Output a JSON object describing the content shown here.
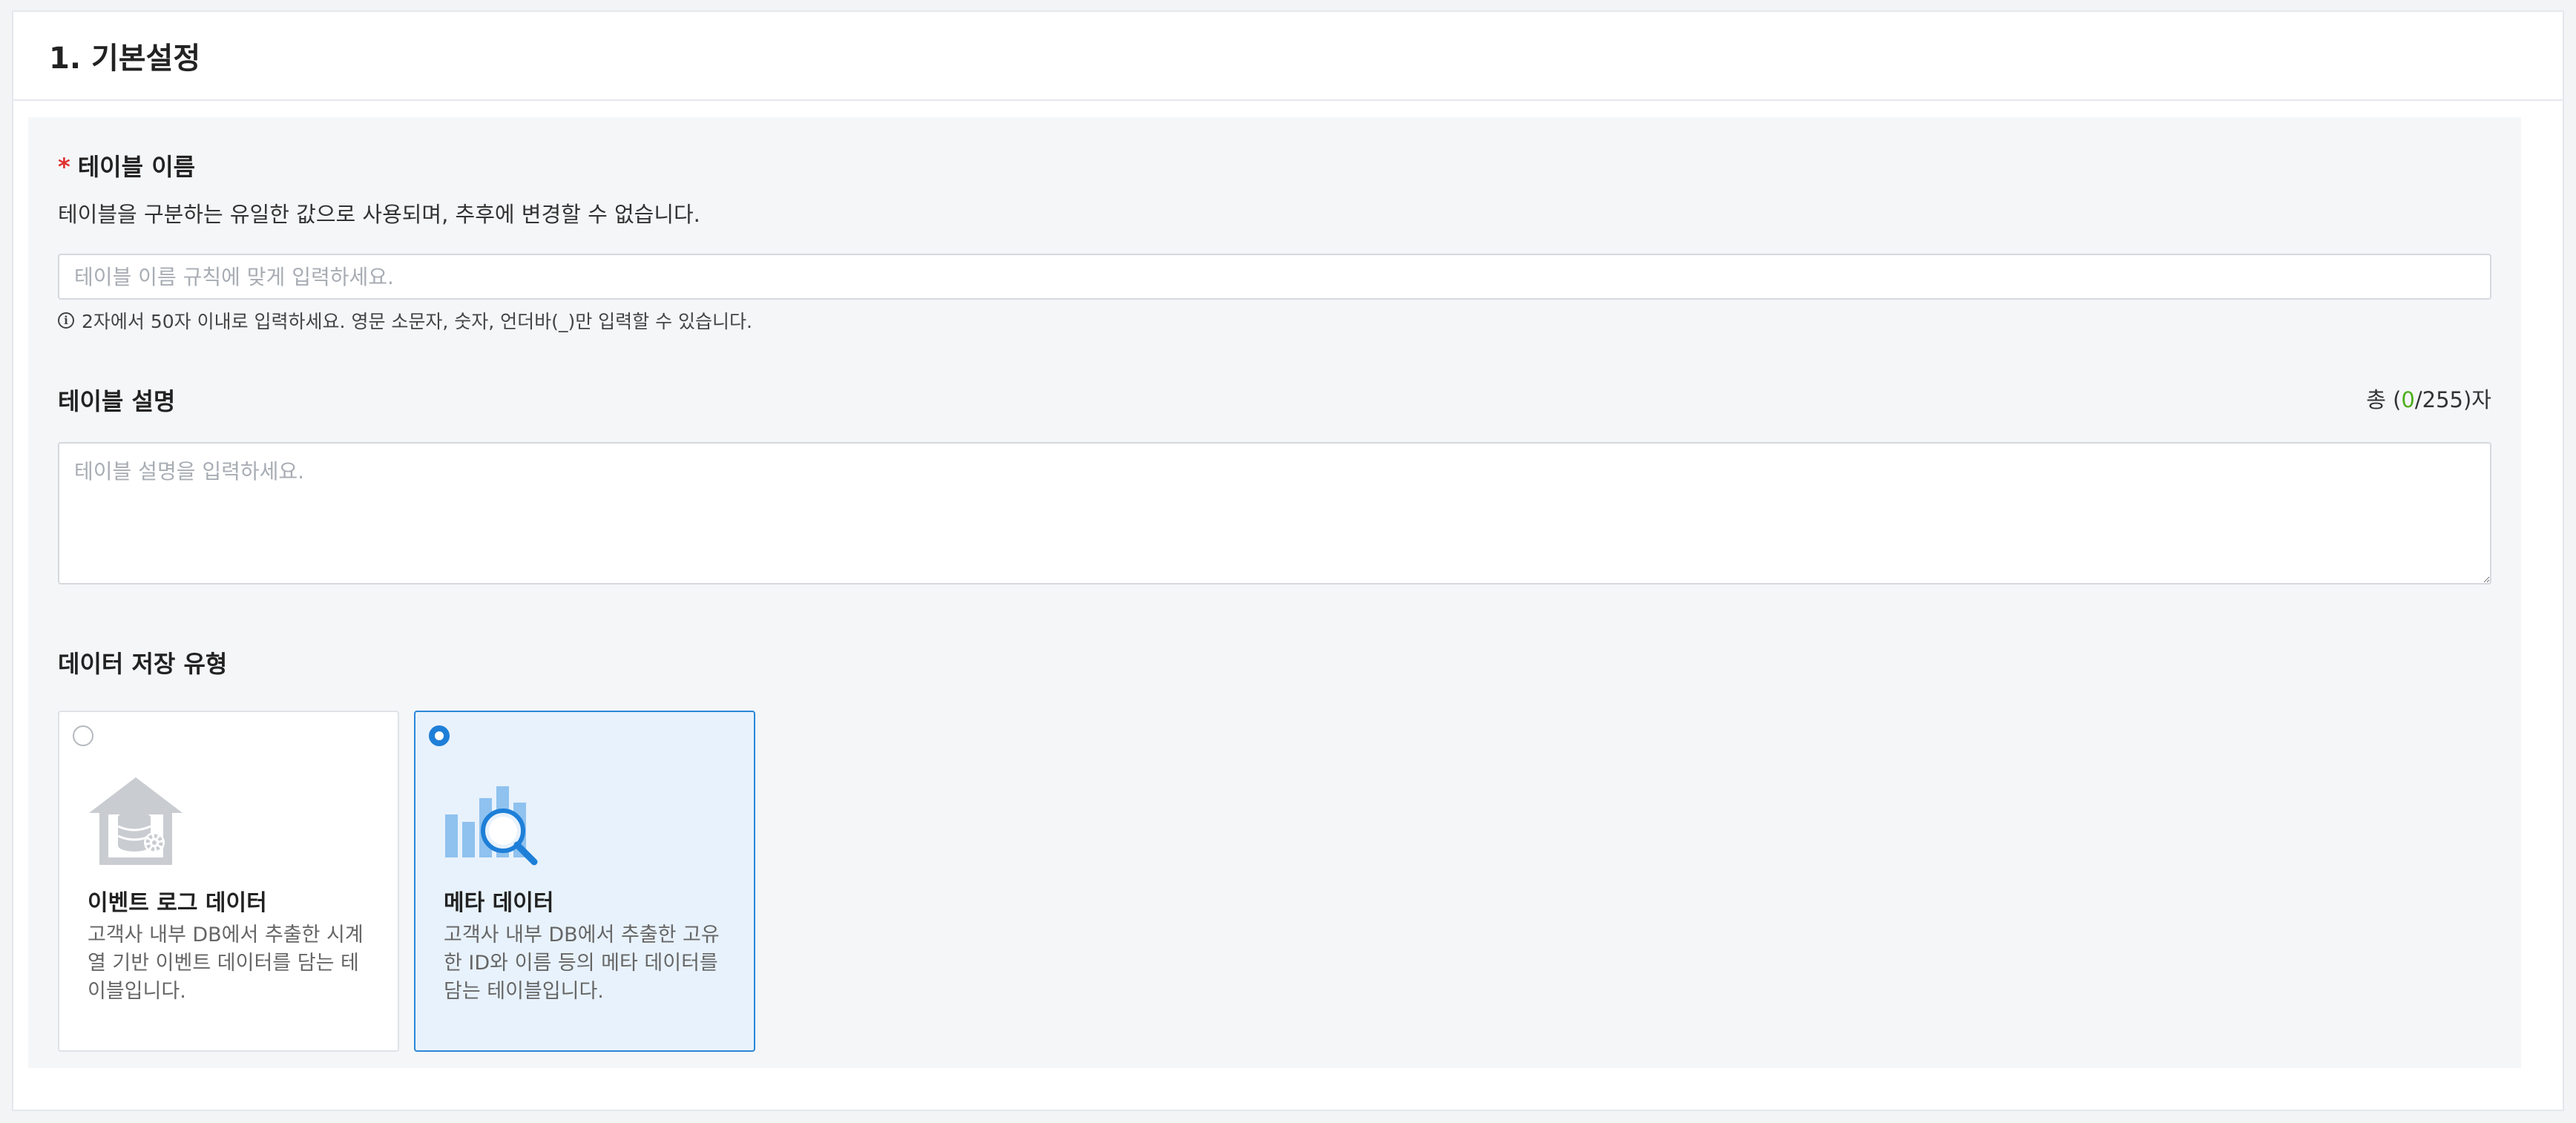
{
  "section": {
    "title": "1. 기본설정"
  },
  "table_name": {
    "required_mark": "*",
    "label": "테이블 이름",
    "description": "테이블을 구분하는 유일한 값으로 사용되며, 추후에 변경할 수 없습니다.",
    "value": "",
    "placeholder": "테이블 이름 규칙에 맞게 입력하세요.",
    "hint_icon": "info-icon",
    "hint": "2자에서 50자 이내로 입력하세요. 영문 소문자, 숫자, 언더바(_)만 입력할 수 있습니다."
  },
  "table_description": {
    "label": "테이블 설명",
    "counter_prefix": "총 (",
    "counter_current": "0",
    "counter_suffix": "/255)자",
    "value": "",
    "placeholder": "테이블 설명을 입력하세요."
  },
  "storage_type": {
    "label": "데이터 저장 유형",
    "selected": "meta",
    "options": [
      {
        "id": "event_log",
        "icon": "database-house-icon",
        "title": "이벤트 로그 데이터",
        "description": "고객사 내부 DB에서 추출한 시계열 기반 이벤트 데이터를 담는 테이블입니다.",
        "selected": false
      },
      {
        "id": "meta",
        "icon": "chart-search-icon",
        "title": "메타 데이터",
        "description": "고객사 내부 DB에서 추출한 고유한 ID와 이름 등의 메타 데이터를 담는 테이블입니다.",
        "selected": true
      }
    ]
  },
  "colors": {
    "accent": "#2b87d9",
    "selected_bg": "#e8f2fc",
    "required": "#e03131",
    "counter_current": "#4caf1a"
  }
}
